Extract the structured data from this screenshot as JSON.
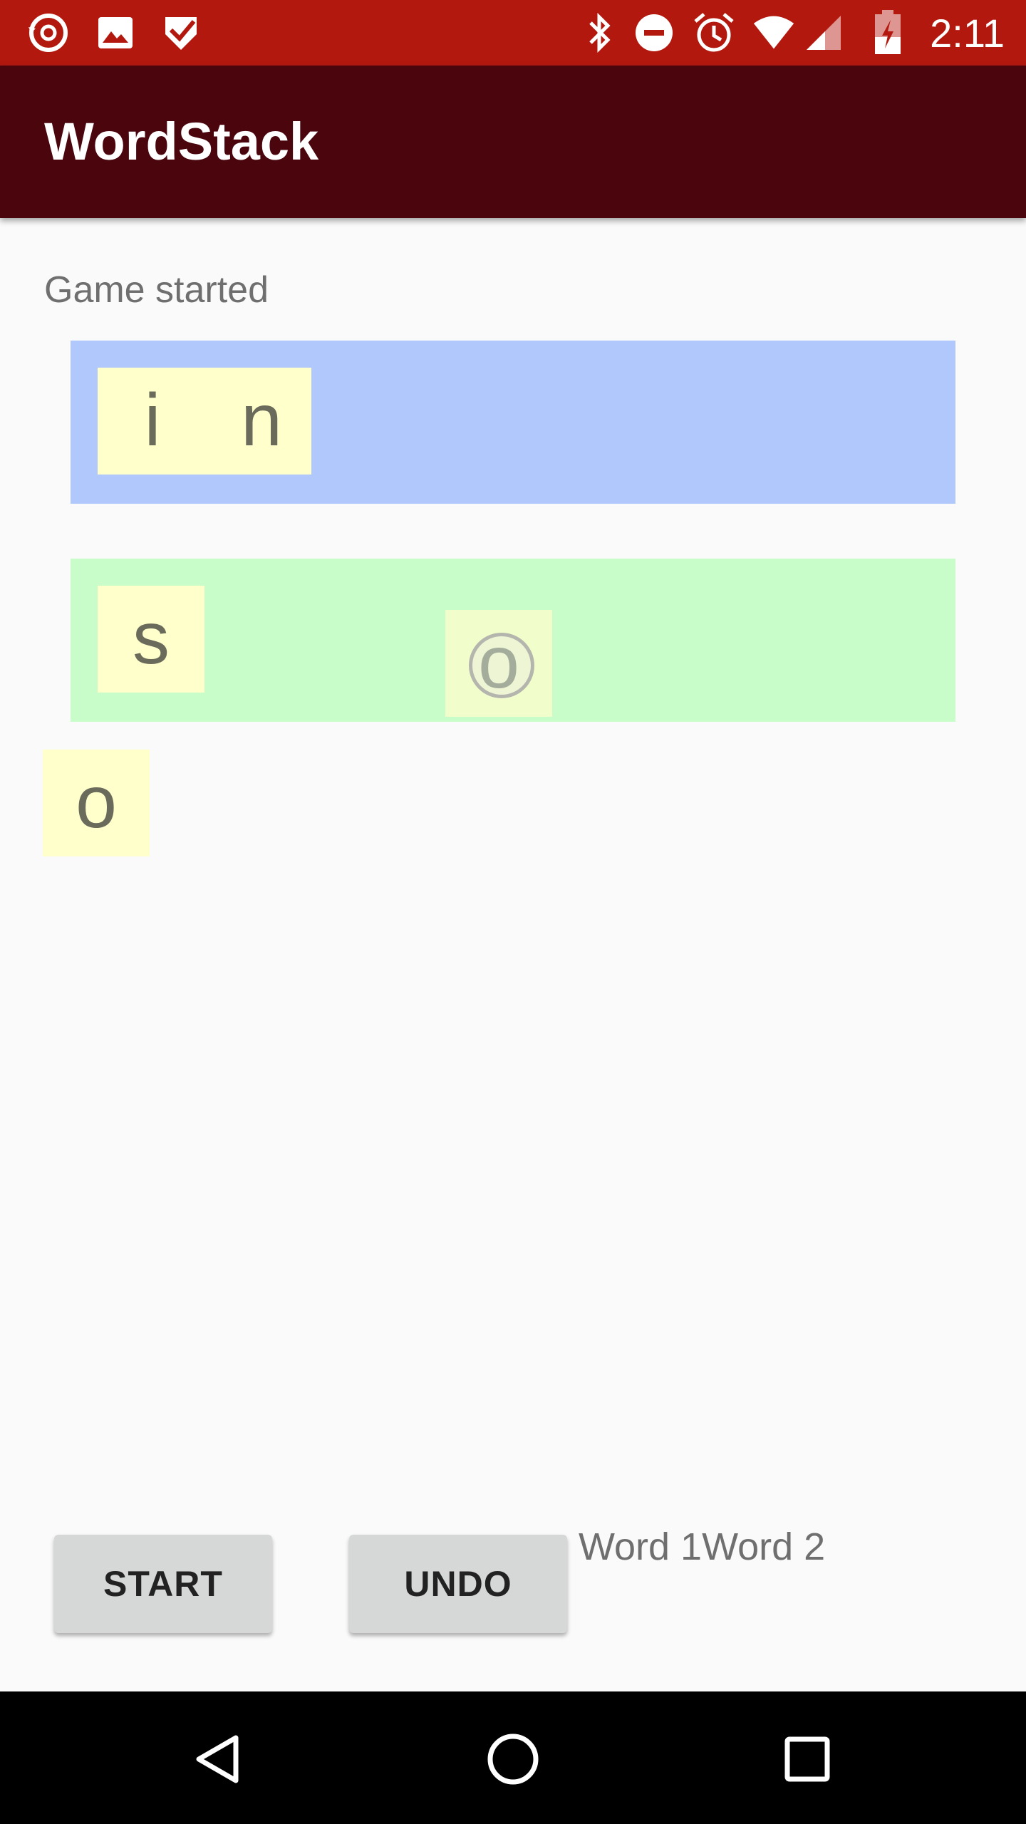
{
  "status_bar": {
    "time": "2:11",
    "left_icons": [
      "sync-icon",
      "image-icon",
      "checkmark-shield-icon"
    ],
    "right_icons": [
      "bluetooth-icon",
      "do-not-disturb-icon",
      "alarm-icon",
      "wifi-icon",
      "cell-signal-icon",
      "battery-charging-icon"
    ],
    "color": "#b3180e"
  },
  "app_bar": {
    "title": "WordStack",
    "color": "#4a050d"
  },
  "game": {
    "status": "Game started",
    "stack1_color": "#b0c8fc",
    "stack2_color": "#c8fcc8",
    "tile_color": "#ffffcc",
    "stack1_tiles": [
      "i",
      "n"
    ],
    "stack2_tiles": [
      "s",
      "o"
    ],
    "loose_tiles": [
      "o"
    ],
    "words_label": "Word 1Word 2"
  },
  "buttons": {
    "start": "START",
    "undo": "UNDO"
  },
  "nav_bar": {
    "back": "back-icon",
    "home": "home-icon",
    "recents": "recents-icon"
  }
}
